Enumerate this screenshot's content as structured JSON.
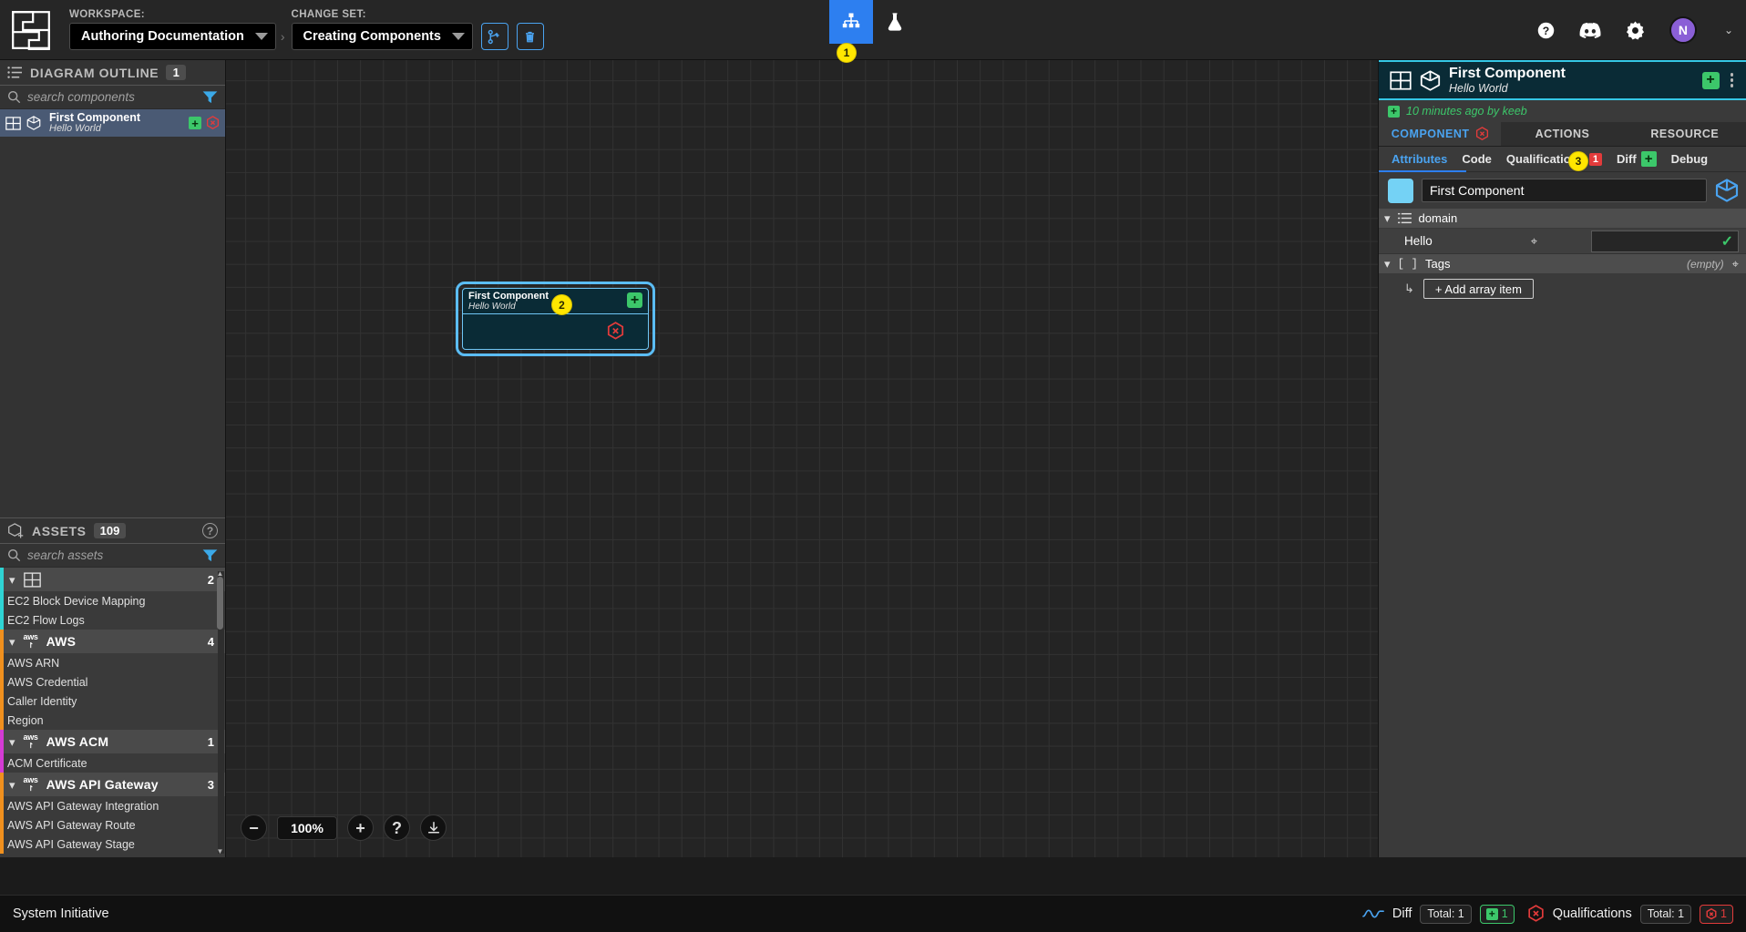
{
  "topbar": {
    "workspace_label": "WORKSPACE:",
    "workspace_value": "Authoring Documentation",
    "breadcrumb_sep": "›",
    "changeset_label": "CHANGE SET:",
    "changeset_value": "Creating Components",
    "merge_icon": "merge-changeset-icon",
    "delete_icon": "trash-icon",
    "tab_model_icon": "model-hierarchy-icon",
    "tab_lab_icon": "flask-icon",
    "help_icon": "help-circle-icon",
    "discord_icon": "discord-icon",
    "settings_icon": "gear-icon",
    "avatar_initial": "N",
    "avatar_caret": "⌄",
    "marker_1": "1",
    "accent_blue": "#2d7ff0",
    "avatar_purple": "#8a5fd6"
  },
  "outline": {
    "title": "DIAGRAM OUTLINE",
    "count": "1",
    "search_placeholder": "search components",
    "search_value": "",
    "filter_icon": "funnel-filter-icon",
    "items": [
      {
        "name": "First Component",
        "subtitle": "Hello World",
        "add_label": "+"
      }
    ]
  },
  "assets": {
    "title": "ASSETS",
    "count": "109",
    "search_placeholder": "search assets",
    "search_value": "",
    "filter_icon": "funnel-filter-icon",
    "help_label": "?",
    "groups": [
      {
        "name": "",
        "count": "2",
        "accent": "#2fd4d4",
        "icon": "schema-grid-icon",
        "items": [
          "EC2 Block Device Mapping",
          "EC2 Flow Logs"
        ]
      },
      {
        "name": "AWS",
        "count": "4",
        "accent": "#f0901e",
        "icon": "aws-logo-icon",
        "items": [
          "AWS ARN",
          "AWS Credential",
          "Caller Identity",
          "Region"
        ]
      },
      {
        "name": "AWS ACM",
        "count": "1",
        "accent": "#d43bd4",
        "icon": "aws-logo-icon",
        "items": [
          "ACM Certificate"
        ]
      },
      {
        "name": "AWS API Gateway",
        "count": "3",
        "accent": "#f0901e",
        "icon": "aws-logo-icon",
        "items": [
          "AWS API Gateway Integration",
          "AWS API Gateway Route",
          "AWS API Gateway Stage"
        ]
      }
    ]
  },
  "canvas": {
    "node": {
      "title": "First Component",
      "subtitle": "Hello World",
      "add_label": "+",
      "status_icon": "hexagon-x-icon",
      "marker": "2"
    },
    "zoom_out_label": "−",
    "zoom_level": "100%",
    "zoom_in_label": "+",
    "help_label": "?",
    "download_icon": "download-icon"
  },
  "details": {
    "title": "First Component",
    "subtitle": "Hello World",
    "schema_icon": "schema-grid-icon",
    "cube_icon": "cube-icon",
    "add_label": "+",
    "kebab_icon": "more-vertical-icon",
    "meta_text": "10 minutes ago by keeb",
    "tabs": [
      {
        "label": "COMPONENT",
        "active": true,
        "icon": "hexagon-x-icon"
      },
      {
        "label": "ACTIONS",
        "active": false
      },
      {
        "label": "RESOURCE",
        "active": false
      }
    ],
    "subtabs": [
      {
        "label": "Attributes",
        "active": true
      },
      {
        "label": "Code",
        "active": false
      },
      {
        "label": "Qualifications",
        "active": false,
        "badge": "1",
        "badge_color": "#e23b3b"
      },
      {
        "label": "Diff",
        "active": false,
        "badge": "+",
        "badge_color": "#3cc76a"
      },
      {
        "label": "Debug",
        "active": false
      }
    ],
    "marker_3": "3",
    "name_value": "First Component",
    "swatch_color": "#74d2f5",
    "groups": [
      {
        "name": "domain",
        "bracket": "",
        "icon": "list-icon",
        "right": "",
        "attributes": [
          {
            "key": "Hello",
            "value": "",
            "valid": "✓"
          }
        ]
      },
      {
        "name": "Tags",
        "bracket": "[ ]",
        "icon": "",
        "right": "(empty)",
        "attributes": []
      }
    ],
    "add_array_label": "+  Add array item",
    "add_array_arrow": "↳"
  },
  "statusbar": {
    "brand": "System Initiative",
    "diff_label": "Diff",
    "diff_icon": "wave-icon",
    "diff_total": "Total: 1",
    "diff_added": "1",
    "qual_label": "Qualifications",
    "qual_icon": "hexagon-x-icon",
    "qual_total": "Total: 1",
    "qual_failed": "1"
  }
}
